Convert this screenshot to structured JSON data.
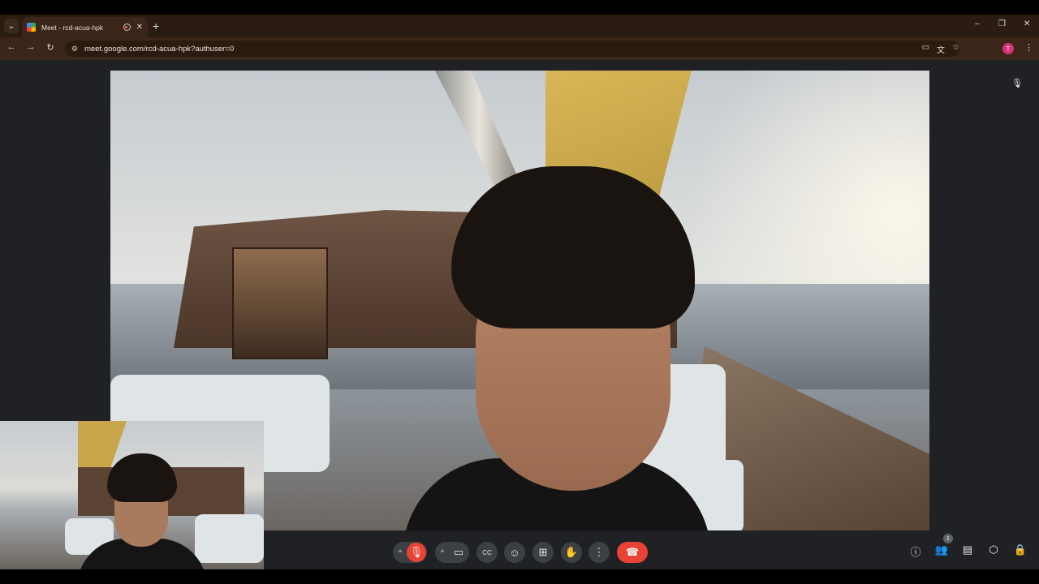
{
  "browser": {
    "tab_title": "Meet - rcd-acua-hpk",
    "tab_close": "✕",
    "new_tab": "+",
    "url": "meet.google.com/rcd-acua-hpk?authuser=0",
    "profile_initial": "T",
    "window_controls": [
      "–",
      "❐",
      "✕"
    ]
  },
  "meet": {
    "participants_count": "1"
  },
  "icons": {
    "tab_search": "⌄",
    "back": "←",
    "forward": "→",
    "reload": "↻",
    "site_info": "⚙",
    "camera": "▭",
    "translate": "文",
    "bookmark": "☆",
    "menu": "⋮",
    "mic_muted": "🎙",
    "chevron_up": "^",
    "video": "▭",
    "captions": "CC",
    "emoji": "☺",
    "present": "⊞",
    "raise_hand": "✋",
    "more": "⋮",
    "end_call": "☎",
    "info": "ⓘ",
    "people": "👥",
    "chat": "▤",
    "activities": "⬡",
    "host_controls": "🔒"
  }
}
